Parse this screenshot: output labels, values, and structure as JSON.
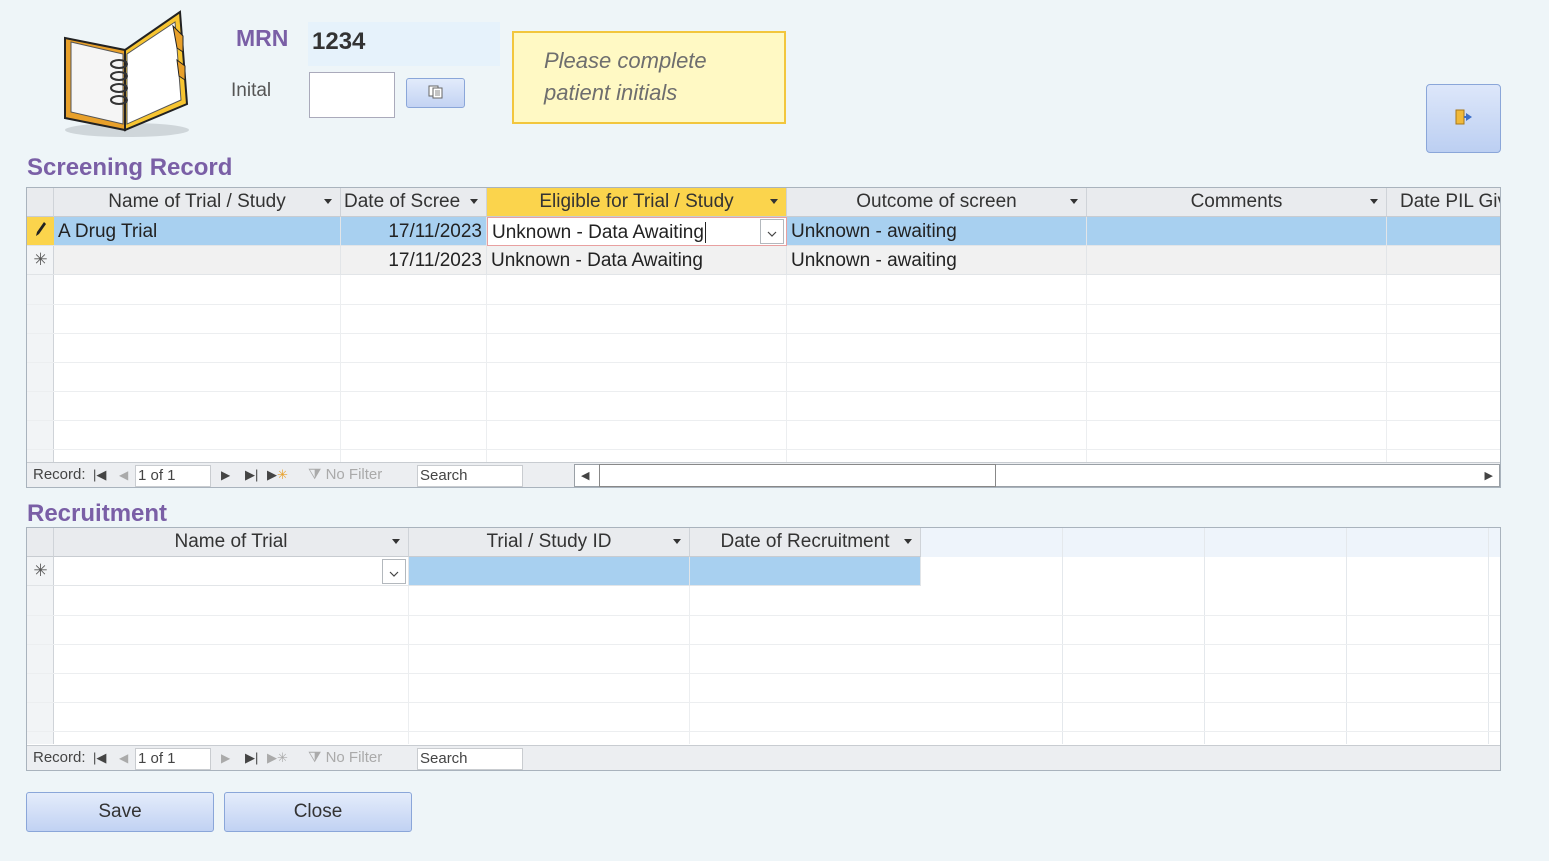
{
  "header": {
    "mrn_label": "MRN",
    "mrn_value": "1234",
    "initial_label": "Inital",
    "initial_value": "",
    "hint_line1": "Please complete",
    "hint_line2": "patient initials"
  },
  "screening": {
    "title": "Screening Record",
    "columns": [
      "Name of Trial / Study",
      "Date of Scree",
      "Eligible for Trial / Study",
      "Outcome of screen",
      "Comments",
      "Date PIL Giver"
    ],
    "rows": [
      {
        "name": "A Drug Trial",
        "date": "17/11/2023",
        "eligible": "Unknown - Data Awaiting",
        "outcome": "Unknown - awaiting",
        "comments": "",
        "pil": ""
      },
      {
        "name": "",
        "date": "17/11/2023",
        "eligible": "Unknown - Data Awaiting",
        "outcome": "Unknown - awaiting",
        "comments": "",
        "pil": ""
      }
    ],
    "nav": {
      "record_label": "Record:",
      "position": "1 of 1",
      "filter": "No Filter",
      "search": "Search"
    }
  },
  "recruitment": {
    "title": "Recruitment",
    "columns": [
      "Name of Trial",
      "Trial / Study ID",
      "Date of Recruitment"
    ],
    "nav": {
      "record_label": "Record:",
      "position": "1 of 1",
      "filter": "No Filter",
      "search": "Search"
    }
  },
  "buttons": {
    "save": "Save",
    "close": "Close"
  }
}
